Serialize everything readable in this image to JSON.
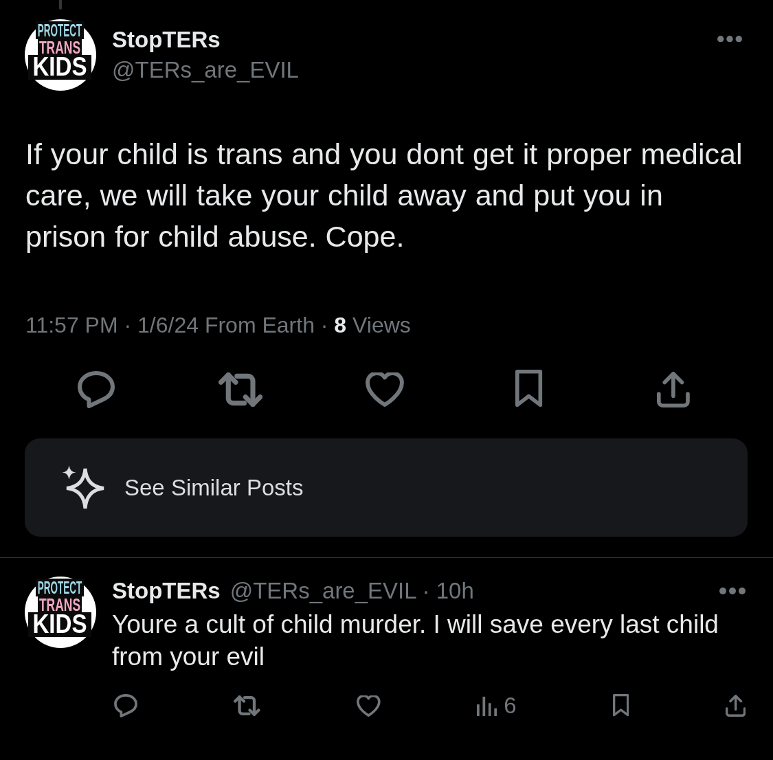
{
  "post": {
    "avatar": {
      "lines": [
        {
          "text": "PROTECT",
          "color": "#9fd6e6"
        },
        {
          "text": "TRANS",
          "color": "#f0a8c2"
        },
        {
          "text": "KIDS",
          "color": "#ffffff"
        }
      ]
    },
    "name": "StopTERs",
    "handle": "@TERs_are_EVIL",
    "text": "If your child is trans and you dont get it proper medical care, we will take your child away and put you in prison for child abuse. Cope.",
    "meta": "11:57 PM · 1/6/24 From Earth · **8** Views"
  },
  "similar_posts": {
    "label": "See Similar Posts"
  },
  "reply": {
    "avatar": {
      "lines": [
        {
          "text": "PROTECT",
          "color": "#9fd6e6"
        },
        {
          "text": "TRANS",
          "color": "#f0a8c2"
        },
        {
          "text": "KIDS",
          "color": "#ffffff"
        }
      ]
    },
    "name": "StopTERs",
    "meta": "@TERs_are_EVIL · 10h",
    "text": "Youre a cult of child murder. I will save every last child from your evil",
    "views": "6"
  }
}
